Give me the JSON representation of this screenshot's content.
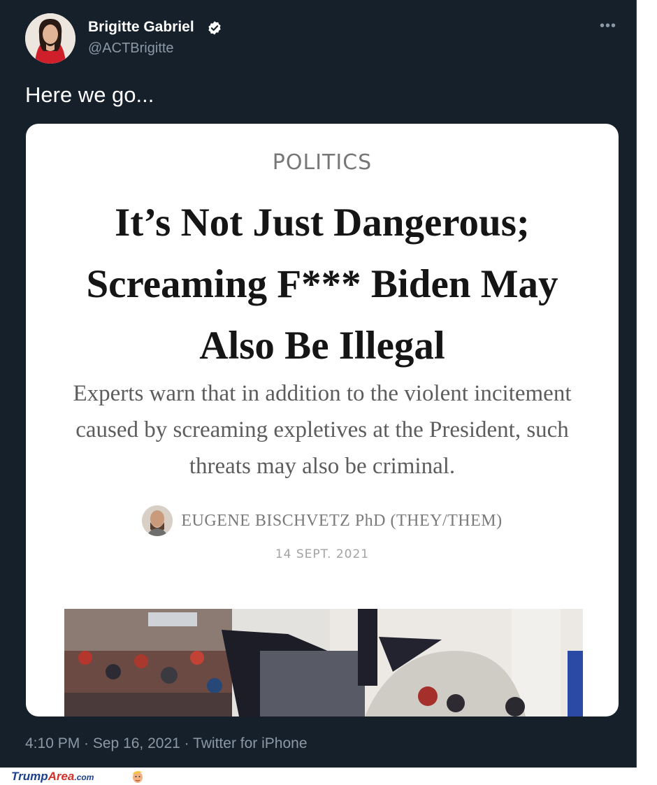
{
  "tweet": {
    "display_name": "Brigitte Gabriel",
    "handle": "@ACTBrigitte",
    "more_label": "•••",
    "text": "Here we go...",
    "timestamp": "4:10 PM · Sep 16, 2021 · Twitter for iPhone",
    "verified_icon": "verified-badge-icon"
  },
  "article": {
    "section": "POLITICS",
    "headline": "It’s Not Just Dangerous; Screaming F*** Biden May Also Be Illegal",
    "dek": "Experts warn that in addition to the violent incitement caused by screaming expletives at the President, such threats may also be criminal.",
    "author": "EUGENE BISCHVETZ PhD (THEY/THEM)",
    "date": "14 SEPT. 2021"
  },
  "watermark": {
    "brand_part1": "Trump",
    "brand_part2": "Area",
    "brand_suffix": ".com"
  },
  "colors": {
    "background": "#15202b",
    "text_primary": "#ffffff",
    "text_secondary": "#8b98a5",
    "verified": "#ffffff"
  }
}
